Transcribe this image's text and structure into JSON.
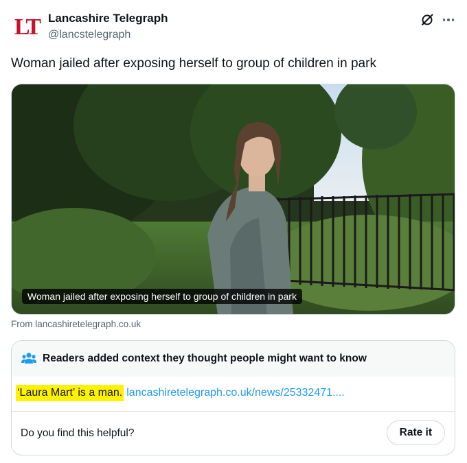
{
  "account": {
    "avatar_text": "LT",
    "display_name": "Lancashire Telegraph",
    "handle": "@lancstelegraph"
  },
  "icons": {
    "grok": "grok-icon",
    "more": "more-icon",
    "people": "people-icon"
  },
  "tweet": {
    "text": "Woman jailed after exposing herself to group of children in park"
  },
  "media": {
    "caption": "Woman jailed after exposing herself to group of children in park",
    "source": "From lancashiretelegraph.co.uk"
  },
  "community_note": {
    "title": "Readers added context they thought people might want to know",
    "highlighted_text": "‘Laura Mart’ is a man.",
    "link_text": "lancashiretelegraph.co.uk/news/25332471....",
    "helpful_prompt": "Do you find this helpful?",
    "rate_button": "Rate it"
  },
  "colors": {
    "accent_link": "#1d9bf0",
    "highlight": "#fff200",
    "logo_red": "#c8102e",
    "secondary_text": "#536471"
  }
}
